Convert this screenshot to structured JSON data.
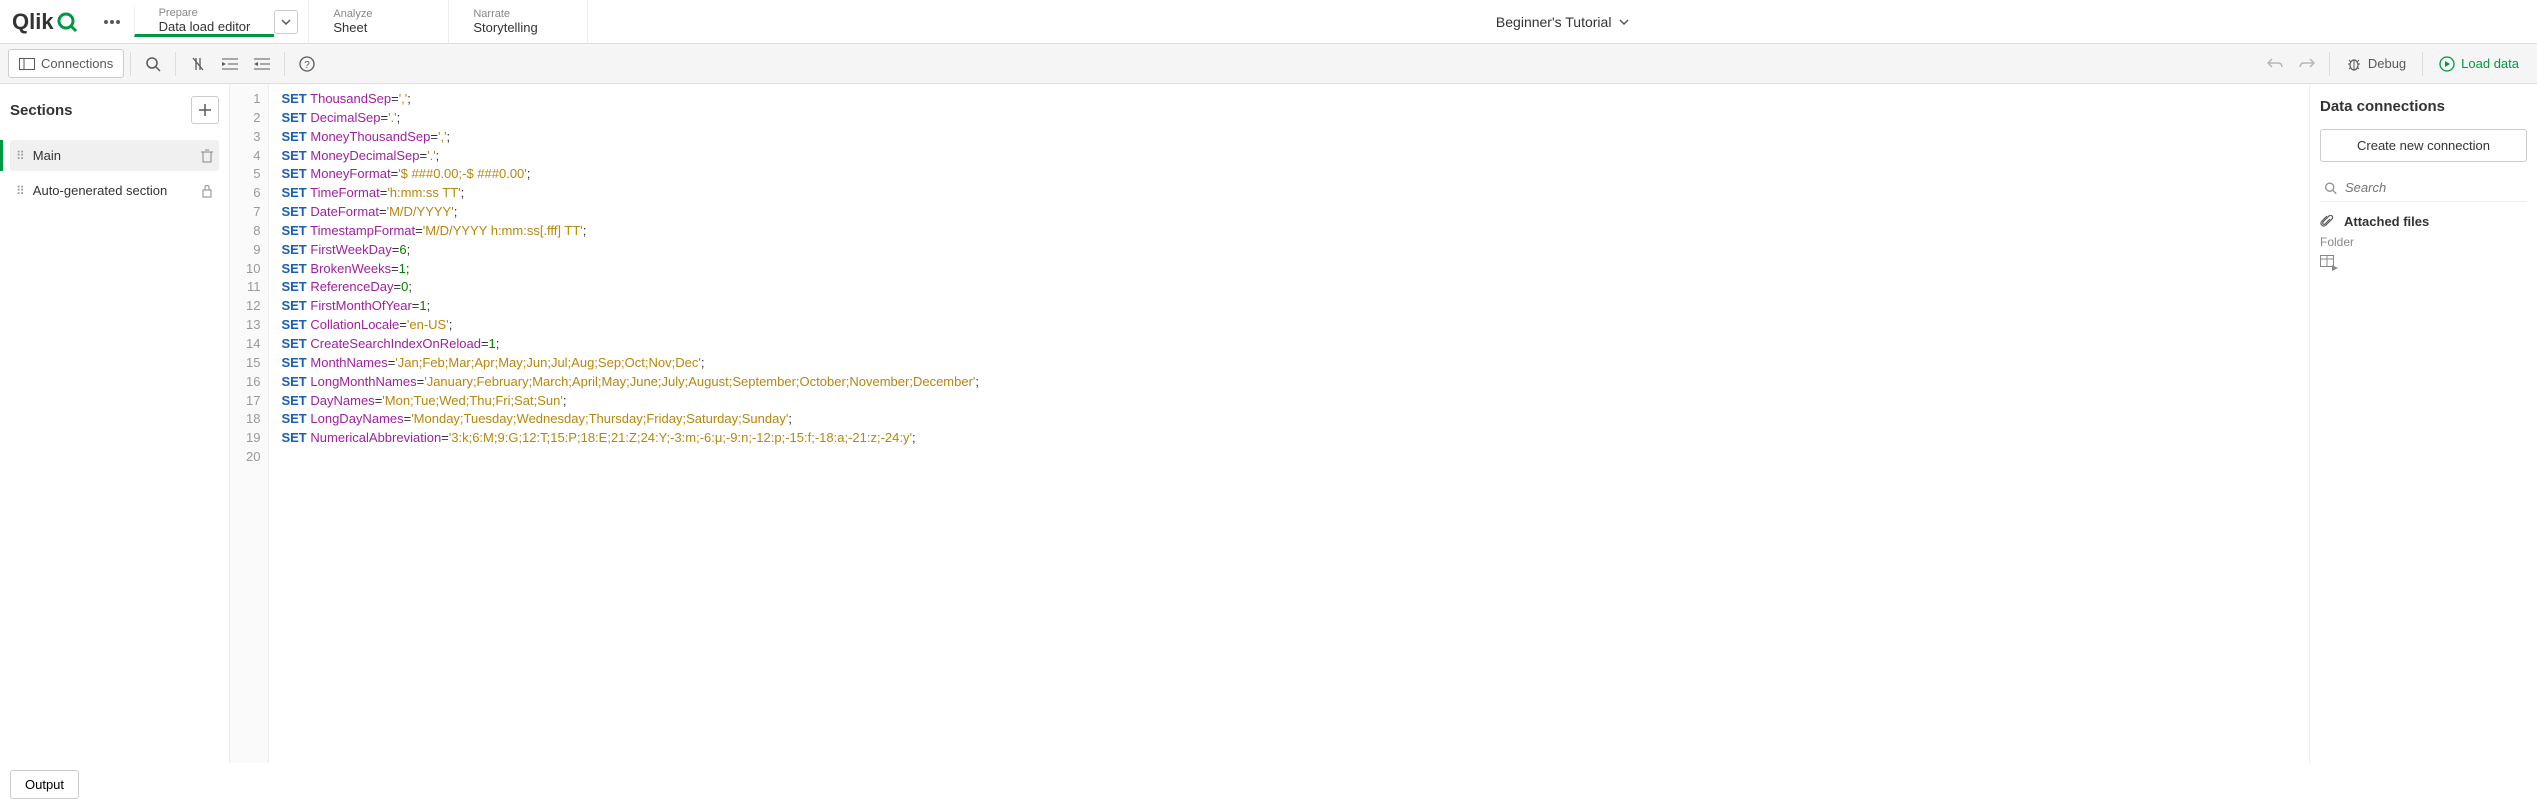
{
  "app_title": "Beginner's Tutorial",
  "nav": {
    "prepare": {
      "small": "Prepare",
      "big": "Data load editor"
    },
    "analyze": {
      "small": "Analyze",
      "big": "Sheet"
    },
    "narrate": {
      "small": "Narrate",
      "big": "Storytelling"
    }
  },
  "toolbar": {
    "connections": "Connections",
    "debug": "Debug",
    "load_data": "Load data"
  },
  "sections": {
    "title": "Sections",
    "items": [
      {
        "label": "Main"
      },
      {
        "label": "Auto-generated section"
      }
    ]
  },
  "right": {
    "title": "Data connections",
    "create": "Create new connection",
    "search_placeholder": "Search",
    "attached": "Attached files",
    "folder": "Folder"
  },
  "footer": {
    "output": "Output"
  },
  "code": [
    {
      "n": 1,
      "t": [
        [
          "kw",
          "SET"
        ],
        [
          "sp",
          " "
        ],
        [
          "var",
          "ThousandSep"
        ],
        [
          "eq",
          "="
        ],
        [
          "str",
          "','"
        ],
        [
          "eq",
          ";"
        ]
      ]
    },
    {
      "n": 2,
      "t": [
        [
          "kw",
          "SET"
        ],
        [
          "sp",
          " "
        ],
        [
          "var",
          "DecimalSep"
        ],
        [
          "eq",
          "="
        ],
        [
          "str",
          "'.'"
        ],
        [
          "eq",
          ";"
        ]
      ]
    },
    {
      "n": 3,
      "t": [
        [
          "kw",
          "SET"
        ],
        [
          "sp",
          " "
        ],
        [
          "var",
          "MoneyThousandSep"
        ],
        [
          "eq",
          "="
        ],
        [
          "str",
          "','"
        ],
        [
          "eq",
          ";"
        ]
      ]
    },
    {
      "n": 4,
      "t": [
        [
          "kw",
          "SET"
        ],
        [
          "sp",
          " "
        ],
        [
          "var",
          "MoneyDecimalSep"
        ],
        [
          "eq",
          "="
        ],
        [
          "str",
          "'.'"
        ],
        [
          "eq",
          ";"
        ]
      ]
    },
    {
      "n": 5,
      "t": [
        [
          "kw",
          "SET"
        ],
        [
          "sp",
          " "
        ],
        [
          "var",
          "MoneyFormat"
        ],
        [
          "eq",
          "="
        ],
        [
          "str",
          "'$ ###0.00;-$ ###0.00'"
        ],
        [
          "eq",
          ";"
        ]
      ]
    },
    {
      "n": 6,
      "t": [
        [
          "kw",
          "SET"
        ],
        [
          "sp",
          " "
        ],
        [
          "var",
          "TimeFormat"
        ],
        [
          "eq",
          "="
        ],
        [
          "str",
          "'h:mm:ss TT'"
        ],
        [
          "eq",
          ";"
        ]
      ]
    },
    {
      "n": 7,
      "t": [
        [
          "kw",
          "SET"
        ],
        [
          "sp",
          " "
        ],
        [
          "var",
          "DateFormat"
        ],
        [
          "eq",
          "="
        ],
        [
          "str",
          "'M/D/YYYY'"
        ],
        [
          "eq",
          ";"
        ]
      ]
    },
    {
      "n": 8,
      "t": [
        [
          "kw",
          "SET"
        ],
        [
          "sp",
          " "
        ],
        [
          "var",
          "TimestampFormat"
        ],
        [
          "eq",
          "="
        ],
        [
          "str",
          "'M/D/YYYY h:mm:ss[.fff] TT'"
        ],
        [
          "eq",
          ";"
        ]
      ]
    },
    {
      "n": 9,
      "t": [
        [
          "kw",
          "SET"
        ],
        [
          "sp",
          " "
        ],
        [
          "var",
          "FirstWeekDay"
        ],
        [
          "eq",
          "="
        ],
        [
          "num",
          "6"
        ],
        [
          "eq",
          ";"
        ]
      ]
    },
    {
      "n": 10,
      "t": [
        [
          "kw",
          "SET"
        ],
        [
          "sp",
          " "
        ],
        [
          "var",
          "BrokenWeeks"
        ],
        [
          "eq",
          "="
        ],
        [
          "num",
          "1"
        ],
        [
          "eq",
          ";"
        ]
      ]
    },
    {
      "n": 11,
      "t": [
        [
          "kw",
          "SET"
        ],
        [
          "sp",
          " "
        ],
        [
          "var",
          "ReferenceDay"
        ],
        [
          "eq",
          "="
        ],
        [
          "num",
          "0"
        ],
        [
          "eq",
          ";"
        ]
      ]
    },
    {
      "n": 12,
      "t": [
        [
          "kw",
          "SET"
        ],
        [
          "sp",
          " "
        ],
        [
          "var",
          "FirstMonthOfYear"
        ],
        [
          "eq",
          "="
        ],
        [
          "num",
          "1"
        ],
        [
          "eq",
          ";"
        ]
      ]
    },
    {
      "n": 13,
      "t": [
        [
          "kw",
          "SET"
        ],
        [
          "sp",
          " "
        ],
        [
          "var",
          "CollationLocale"
        ],
        [
          "eq",
          "="
        ],
        [
          "str",
          "'en-US'"
        ],
        [
          "eq",
          ";"
        ]
      ]
    },
    {
      "n": 14,
      "t": [
        [
          "kw",
          "SET"
        ],
        [
          "sp",
          " "
        ],
        [
          "var",
          "CreateSearchIndexOnReload"
        ],
        [
          "eq",
          "="
        ],
        [
          "num",
          "1"
        ],
        [
          "eq",
          ";"
        ]
      ]
    },
    {
      "n": 15,
      "t": [
        [
          "kw",
          "SET"
        ],
        [
          "sp",
          " "
        ],
        [
          "var",
          "MonthNames"
        ],
        [
          "eq",
          "="
        ],
        [
          "str",
          "'Jan;Feb;Mar;Apr;May;Jun;Jul;Aug;Sep;Oct;Nov;Dec'"
        ],
        [
          "eq",
          ";"
        ]
      ]
    },
    {
      "n": 16,
      "t": [
        [
          "kw",
          "SET"
        ],
        [
          "sp",
          " "
        ],
        [
          "var",
          "LongMonthNames"
        ],
        [
          "eq",
          "="
        ],
        [
          "str",
          "'January;February;March;April;May;June;July;August;September;October;November;December'"
        ],
        [
          "eq",
          ";"
        ]
      ]
    },
    {
      "n": 17,
      "t": [
        [
          "kw",
          "SET"
        ],
        [
          "sp",
          " "
        ],
        [
          "var",
          "DayNames"
        ],
        [
          "eq",
          "="
        ],
        [
          "str",
          "'Mon;Tue;Wed;Thu;Fri;Sat;Sun'"
        ],
        [
          "eq",
          ";"
        ]
      ]
    },
    {
      "n": 18,
      "t": [
        [
          "kw",
          "SET"
        ],
        [
          "sp",
          " "
        ],
        [
          "var",
          "LongDayNames"
        ],
        [
          "eq",
          "="
        ],
        [
          "str",
          "'Monday;Tuesday;Wednesday;Thursday;Friday;Saturday;Sunday'"
        ],
        [
          "eq",
          ";"
        ]
      ]
    },
    {
      "n": 19,
      "t": [
        [
          "kw",
          "SET"
        ],
        [
          "sp",
          " "
        ],
        [
          "var",
          "NumericalAbbreviation"
        ],
        [
          "eq",
          "="
        ],
        [
          "str",
          "'3:k;6:M;9:G;12:T;15:P;18:E;21:Z;24:Y;-3:m;-6:μ;-9:n;-12:p;-15:f;-18:a;-21:z;-24:y'"
        ],
        [
          "eq",
          ";"
        ]
      ]
    },
    {
      "n": 20,
      "t": []
    }
  ]
}
